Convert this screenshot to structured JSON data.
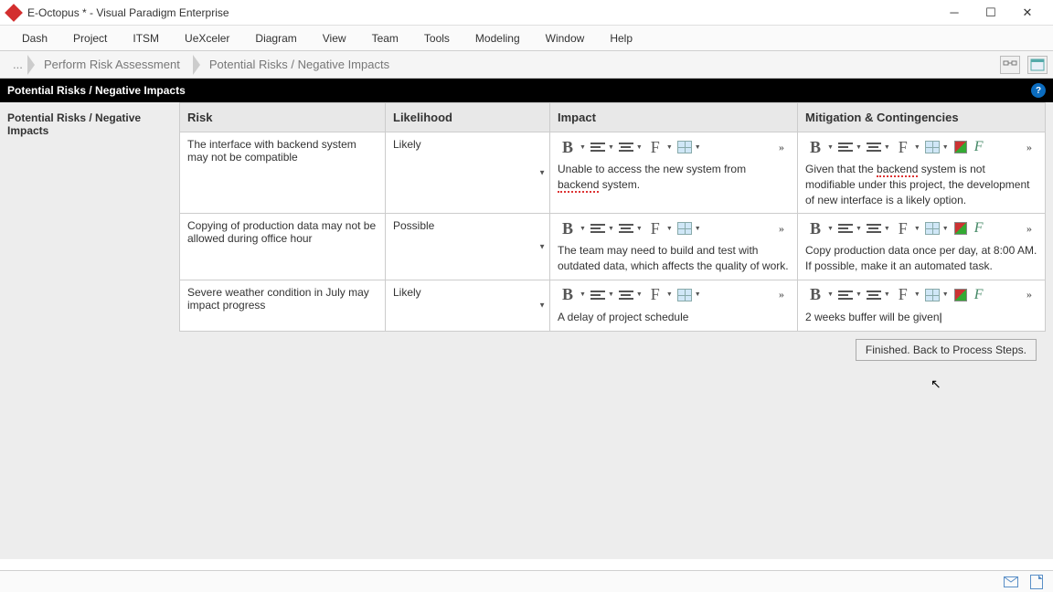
{
  "window": {
    "title": "E-Octopus * - Visual Paradigm Enterprise"
  },
  "menu": [
    "Dash",
    "Project",
    "ITSM",
    "UeXceler",
    "Diagram",
    "View",
    "Team",
    "Tools",
    "Modeling",
    "Window",
    "Help"
  ],
  "breadcrumb": {
    "home": "...",
    "items": [
      "Perform Risk Assessment",
      "Potential Risks / Negative Impacts"
    ]
  },
  "section_title": "Potential Risks / Negative Impacts",
  "sidebar_title": "Potential Risks / Negative Impacts",
  "table": {
    "headers": {
      "risk": "Risk",
      "likelihood": "Likelihood",
      "impact": "Impact",
      "mitigation": "Mitigation & Contingencies"
    },
    "rows": [
      {
        "risk": "The interface with backend system may not be compatible",
        "likelihood": "Likely",
        "impact_pre": "Unable to access the new system from ",
        "impact_spell": "backend",
        "impact_post": " system.",
        "mitigation_pre": "Given that the ",
        "mitigation_spell": "backend",
        "mitigation_post": " system is not modifiable under this project, the development of new interface is a likely option."
      },
      {
        "risk": "Copying of production data may not be allowed during office hour",
        "likelihood": "Possible",
        "impact": "The team may need to build and test with outdated data, which affects the quality of work.",
        "mitigation": "Copy production data once per day, at 8:00 AM. If possible, make it an automated task."
      },
      {
        "risk": "Severe weather condition in July may impact progress",
        "likelihood": "Likely",
        "impact": "A delay of project schedule",
        "mitigation": "2 weeks buffer will be given"
      }
    ]
  },
  "finished_btn": "Finished. Back to Process Steps."
}
